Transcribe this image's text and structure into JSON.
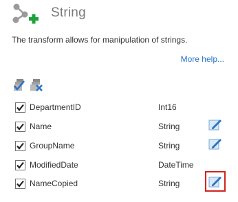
{
  "header": {
    "title": "String",
    "logo_icon": "transform-add-icon"
  },
  "description": "The transform allows for manipulation of strings.",
  "more_help_label": "More help...",
  "toolbar": {
    "select_all_icon": "select-all-icon",
    "deselect_all_icon": "deselect-all-icon"
  },
  "fields": [
    {
      "name": "DepartmentID",
      "type": "Int16",
      "checked": true,
      "editable": false
    },
    {
      "name": "Name",
      "type": "String",
      "checked": true,
      "editable": true
    },
    {
      "name": "GroupName",
      "type": "String",
      "checked": true,
      "editable": true
    },
    {
      "name": "ModifiedDate",
      "type": "DateTime",
      "checked": true,
      "editable": false
    },
    {
      "name": "NameCopied",
      "type": "String",
      "checked": true,
      "editable": true,
      "highlighted": true
    }
  ],
  "colors": {
    "accent_green": "#1aa33a",
    "link_blue": "#2a73c6",
    "highlight_red": "#d42121"
  }
}
